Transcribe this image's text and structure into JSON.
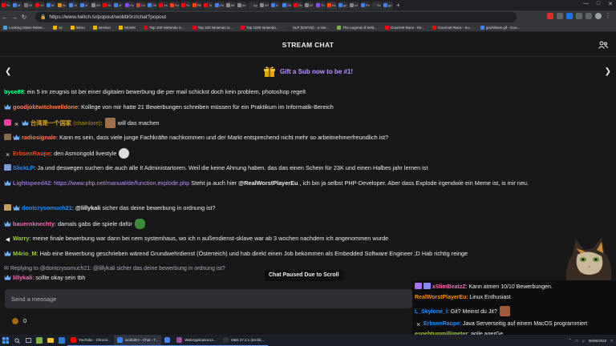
{
  "browser": {
    "url": "https://www.twitch.tv/popout/wobbl0rz/chat?popout",
    "tabs": [
      {
        "label": "Yo",
        "color": "#ff0000"
      },
      {
        "label": "M",
        "color": "#4285f4"
      },
      {
        "label": "Ri",
        "color": "#777777"
      },
      {
        "label": "Yo",
        "color": "#ff0000"
      },
      {
        "label": "M",
        "color": "#4285f4"
      },
      {
        "label": "Ar",
        "color": "#e38b2c"
      },
      {
        "label": "Gi",
        "color": "#4c8bf5"
      },
      {
        "label": "M",
        "color": "#4285f4"
      },
      {
        "label": "Wi",
        "color": "#888888"
      },
      {
        "label": "Yo",
        "color": "#ff0000"
      },
      {
        "label": "M",
        "color": "#4285f4"
      },
      {
        "label": "Hc",
        "color": "#9146ff"
      },
      {
        "label": "Ce",
        "color": "#cc4444"
      },
      {
        "label": "Ge",
        "color": "#4285f4"
      },
      {
        "label": "Ya",
        "color": "#ff0000"
      },
      {
        "label": "Ro",
        "color": "#ff4500"
      },
      {
        "label": "Yo",
        "color": "#ff0000"
      },
      {
        "label": "Re",
        "color": "#ff4500"
      },
      {
        "label": "To",
        "color": "#ff0000"
      },
      {
        "label": "Ge",
        "color": "#4285f4"
      },
      {
        "label": "htt",
        "color": "#888888"
      },
      {
        "label": "he",
        "color": "#888888"
      },
      {
        "label": "Ap",
        "color": "#333333"
      },
      {
        "label": "Wi",
        "color": "#888888"
      },
      {
        "label": "A",
        "color": "#4285f4"
      },
      {
        "label": "Ge",
        "color": "#4285f4"
      },
      {
        "label": "Su",
        "color": "#ff0000"
      },
      {
        "label": "W",
        "color": "#888888"
      },
      {
        "label": "Th",
        "color": "#9146ff"
      },
      {
        "label": "Ac",
        "color": "#ff4500"
      },
      {
        "label": "go",
        "color": "#4285f4"
      },
      {
        "label": "Ini",
        "color": "#888888"
      },
      {
        "label": "Pe",
        "color": "#4285f4"
      },
      {
        "label": "Sc",
        "color": "#333333"
      },
      {
        "label": "go",
        "color": "#4285f4"
      }
    ],
    "bookmarks": [
      {
        "label": "Looking Glass Relea...",
        "color": "#4aa3df"
      },
      {
        "label": "ss",
        "color": "#f4b400"
      },
      {
        "label": "lektro",
        "color": "#f4b400"
      },
      {
        "label": "session",
        "color": "#f4b400"
      },
      {
        "label": "MUSIK",
        "color": "#f4b400"
      },
      {
        "label": "Top 100 Nintendo S...",
        "color": "#e60012"
      },
      {
        "label": "Top 100 Nintendo S...",
        "color": "#e60012"
      },
      {
        "label": "Top 1000 nintendo...",
        "color": "#e60012"
      },
      {
        "label": "ULP (ESP32) - a sim...",
        "color": "#333333"
      },
      {
        "label": "The Legend of Zeld...",
        "color": "#7cb342"
      },
      {
        "label": "Gourmet Race - Kir...",
        "color": "#ff0000"
      },
      {
        "label": "Gourmet Race - Su...",
        "color": "#ff0000"
      },
      {
        "label": "gachibass gif - Goo...",
        "color": "#4285f4"
      }
    ]
  },
  "chat": {
    "header_title": "STREAM CHAT",
    "sub_banner": "Gift a Sub now to be #1!",
    "paused_label": "Chat Paused Due to Scroll",
    "input_placeholder": "Send a message",
    "points_value": "0",
    "messages": [
      {
        "user": "byce88",
        "color": "#00ff7f",
        "text": ": ein 5 im zeugnis ist bei einer digitalen bewerbung die per mail schickst doch kein problem, photoshop regelt"
      },
      {
        "user": "goodjobtwitchwelldone",
        "color": "#ff7f50",
        "text": ": Kollege von mir hatte 21 Bewerbungen schreiben müssen für ein Praktikum im Informatik-Bereich"
      },
      {
        "user": "台湾是一个国家",
        "user2": "(chainlore)",
        "color": "#daa520",
        "text": "will das machen"
      },
      {
        "user": "radiosignale",
        "color": "#ff7f50",
        "text": ": Kann es sein, dass viele junge Fachkräfte nachkommen und der Markt entsprechend nicht mehr so arbeitnehmerfreundlich ist?"
      },
      {
        "user": "ErbsenRaupe",
        "color": "#ff4500",
        "text": ": den Asmongold livestyle"
      },
      {
        "user": "SlickLP",
        "color": "#1e90ff",
        "text": ": Ja und deswegen suchen die auch alle It Administartoren. Weil die keine Ahnung haben. das das einen Schein für 23K und einen Halbes jahr lernen ist"
      },
      {
        "user": "Lightspeed42",
        "color": "#9370db",
        "link": "https://www.php.net/manual/de/function.explode.php",
        "text_a": " Steht ja auch hier ",
        "mention": "@RealWorstPlayerEu",
        "text_b": " , ich bin ja selbst PHP-Developer. Aber dass Explode irgendwie ein Meme ist, is mir neu."
      },
      {
        "user": "dontcrysomuch21",
        "color": "#1e90ff",
        "mention": "@lillykali",
        "text": " sicher das deine bewerbung in ordnung ist?"
      },
      {
        "user": "bauernknechty",
        "color": "#ff69b4",
        "text": ": damals gabs die spiele dafür"
      },
      {
        "user": "Warry",
        "color": "#9acd32",
        "text": ": meine finale bewerbung war dann bei nem systemhaus, wo ich n außendienst-sklave war ab 3 wochen nachdem ich angenommen wurde"
      },
      {
        "user": "M4rio_M",
        "color": "#9acd32",
        "text": ": Hab eine Bewerbung geschrieben wärend Grundwehrdienst (Österreich) und hab direkt einen Job bekommen als Embedded Software Engineer ;D Hab richtig reinge"
      },
      {
        "reply": "Replying to @dontcrysomuch21: @lillykali sicher das deine bewerbung in ordnung ist?"
      },
      {
        "user": "lillykali",
        "color": "#ff69b4",
        "text": ": sollte okay sein tbh"
      }
    ]
  },
  "overlay": {
    "messages": [
      {
        "user": "xSlimBeatzZ",
        "color": "#ff69b4",
        "text": ": Kann atmen 10/10 Bewerbungen."
      },
      {
        "user": "RealWorstPlayerEu",
        "color": "#ff8c00",
        "text": ": Linux Enthusiast"
      },
      {
        "user": "L_Skylone_l",
        "color": "#1e90ff",
        "text": ": Git? Meinst du Jit?"
      },
      {
        "user": "ErbsenRaupe",
        "color": "#1e90ff",
        "text": ": Java Serverseitig auf einem MacOS programmiert"
      },
      {
        "user": "esgehtummillimeter",
        "color": "#9acd32",
        "text": ": agile agerGe"
      }
    ]
  },
  "taskbar": {
    "apps": [
      {
        "label": "YouTube - Chromi...",
        "color": "#ff0000"
      },
      {
        "label": "wobbl0rz - Chat - T...",
        "color": "#4285f4"
      },
      {
        "label": "",
        "color": "#4285f4"
      },
      {
        "label": "WebApplication11...",
        "color": "#9b4f96"
      },
      {
        "label": "OBS 27.2.1 (64-bit,...",
        "color": "#333333"
      }
    ],
    "date": "06/06/2022"
  }
}
